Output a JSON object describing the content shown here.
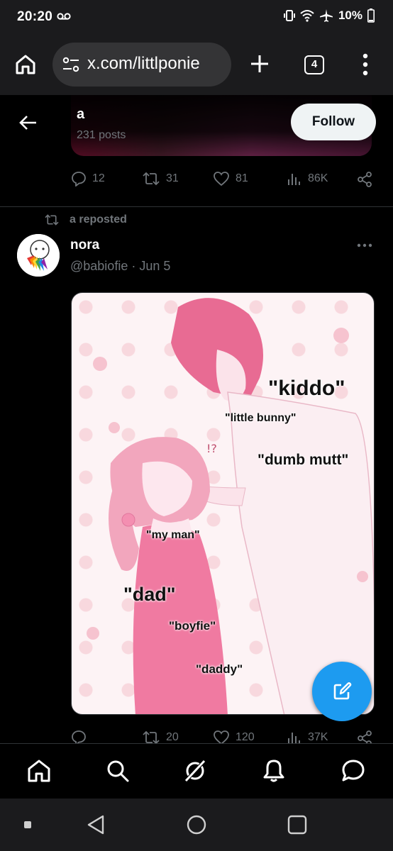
{
  "status_bar": {
    "time": "20:20",
    "battery": "10%"
  },
  "browser": {
    "url": "x.com/littlponie",
    "tab_count": "4"
  },
  "profile_header": {
    "name": "a",
    "post_count": "231 posts",
    "follow_label": "Follow"
  },
  "prev_post_actions": {
    "replies": "12",
    "reposts": "31",
    "likes": "81",
    "views": "86K"
  },
  "post": {
    "repost_label": "a reposted",
    "author_name": "nora",
    "author_meta": "@babiofie · Jun 5",
    "image_texts": {
      "kiddo": "\"kiddo\"",
      "little_bunny": "\"little bunny\"",
      "dumb_mutt": "\"dumb mutt\"",
      "my_man": "\"my man\"",
      "dad": "\"dad\"",
      "boyfie": "\"boyfie\"",
      "daddy": "\"daddy\""
    },
    "actions": {
      "replies": "",
      "reposts": "20",
      "likes": "120",
      "views": "37K"
    }
  },
  "colors": {
    "accent": "#1d9bf0",
    "muted_text": "#71767b",
    "background": "#000000",
    "chrome": "#1b1b1d"
  },
  "bottom_nav": [
    "home-icon",
    "search-icon",
    "grok-icon",
    "notifications-icon",
    "messages-icon"
  ]
}
